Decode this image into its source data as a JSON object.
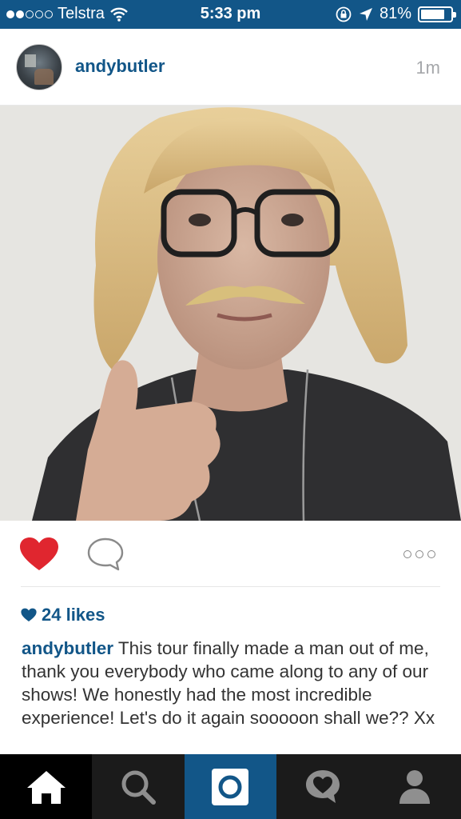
{
  "status_bar": {
    "carrier": "Telstra",
    "signal_bars_filled": 2,
    "signal_bars_total": 5,
    "time": "5:33 pm",
    "battery_percent": "81%",
    "battery_level": 0.81,
    "icons": [
      "wifi-icon",
      "rotation-lock-icon",
      "location-arrow-icon",
      "battery-icon"
    ]
  },
  "post": {
    "username": "andybutler",
    "time_ago": "1m",
    "likes": "24 likes",
    "liked": true,
    "caption_user": "andybutler",
    "caption_text": "This tour finally made a man out of me, thank you everybody who came along to any of our shows! We honestly had the most incredible experience! Let's do it again sooooon shall we?? Xx"
  },
  "tab_bar": {
    "tabs": [
      "home-icon",
      "search-icon",
      "camera-icon",
      "activity-icon",
      "profile-icon"
    ],
    "active": "home-icon"
  },
  "colors": {
    "brand_blue": "#125688",
    "heart_red": "#e0262f",
    "tab_bar_bg": "#1b1b1b"
  }
}
